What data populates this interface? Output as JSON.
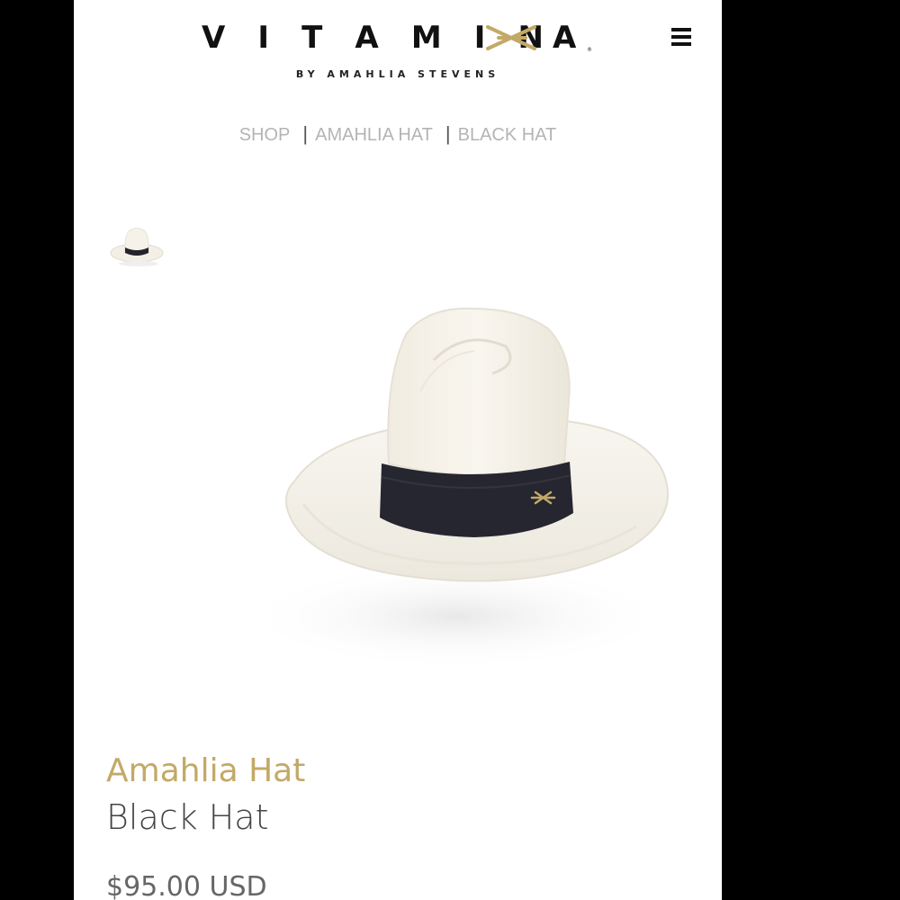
{
  "brand": {
    "logo_letters_left": [
      "V",
      "I",
      "T",
      "A",
      "M",
      "I",
      "N"
    ],
    "logo_letter_right": "A",
    "logo_registered": "®",
    "tagline": "BY AMAHLIA STEVENS",
    "accent_color": "#c3a967"
  },
  "header": {
    "menu_icon": "hamburger-menu-icon"
  },
  "breadcrumb": {
    "items": [
      "SHOP",
      "AMAHLIA HAT",
      "BLACK HAT"
    ],
    "separator": "|"
  },
  "product": {
    "collection": "Amahlia Hat",
    "name": "Black Hat",
    "price": "$95.00 USD",
    "image": "white-panama-hat-with-black-band"
  }
}
